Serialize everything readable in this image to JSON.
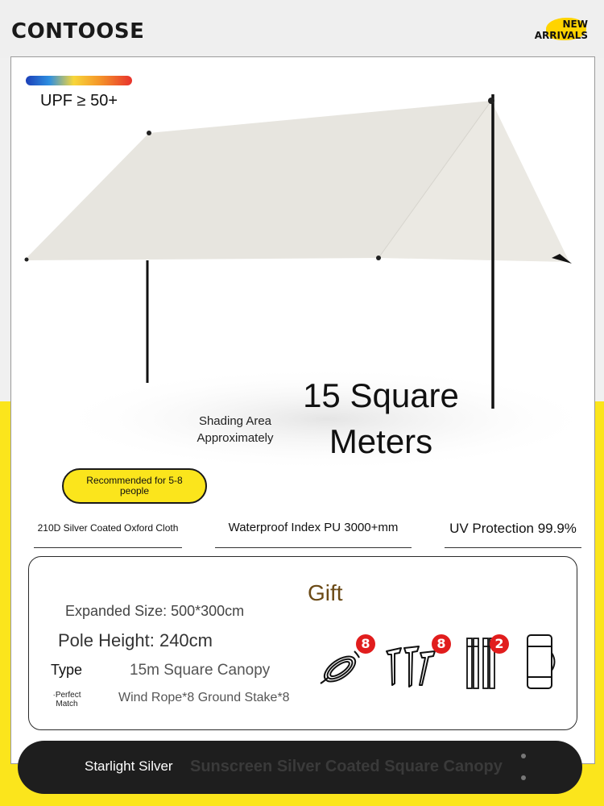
{
  "brand": "CONTOOSE",
  "badge": {
    "line1": "NEW",
    "line2": "ARRIVALS"
  },
  "upf": {
    "label": "UPF ≥ 50+"
  },
  "shading": {
    "area_line1": "15 Square",
    "area_line2": "Meters",
    "caption_line1": "Shading Area",
    "caption_line2": "Approximately"
  },
  "recommendation": "Recommended for 5-8 people",
  "specs": [
    "210D Silver Coated Oxford Cloth",
    "Waterproof Index PU 3000+mm",
    "UV Protection 99.9%"
  ],
  "gift": {
    "title": "Gift",
    "expanded_size": "Expanded Size: 500*300cm",
    "pole_height": "Pole Height: 240cm",
    "type_label": "Type",
    "type_value": "15m Square Canopy",
    "match_label": "·Perfect Match",
    "match_value": "Wind Rope*8 Ground Stake*8",
    "accessories": [
      {
        "icon": "rope-coil-icon",
        "count": "8"
      },
      {
        "icon": "ground-stake-icon",
        "count": "8"
      },
      {
        "icon": "tent-pole-icon",
        "count": "2"
      },
      {
        "icon": "storage-bag-icon",
        "count": ""
      }
    ]
  },
  "footer": {
    "color_name": "Starlight Silver",
    "faded_title": "Sunscreen Silver Coated Square Canopy"
  },
  "colors": {
    "yellow": "#fbe51c",
    "canopy": "#e7e5df",
    "badge_red": "#e11d1d",
    "footer_bar": "#1e1e1e"
  }
}
